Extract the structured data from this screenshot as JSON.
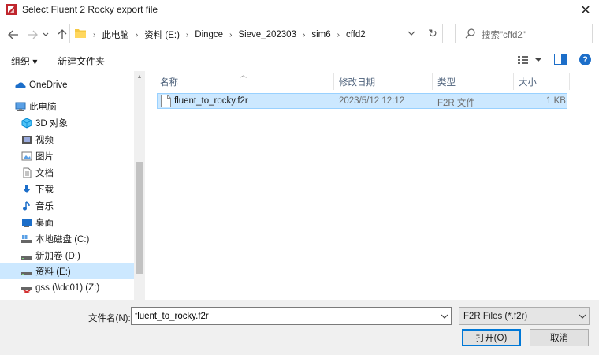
{
  "window": {
    "title": "Select Fluent 2 Rocky export file",
    "close_glyph": "✕"
  },
  "address": {
    "crumbs": [
      "此电脑",
      "资料 (E:)",
      "Dingce",
      "Sieve_202303",
      "sim6",
      "cffd2"
    ],
    "separator": "›",
    "refresh_glyph": "↻"
  },
  "search": {
    "placeholder": "搜索\"cffd2\""
  },
  "toolbar": {
    "organize_label": "组织 ▾",
    "new_folder_label": "新建文件夹",
    "help_glyph": "?"
  },
  "nav": {
    "items": [
      {
        "label": "OneDrive",
        "icon": "cloud-icon"
      },
      {
        "label": "此电脑",
        "icon": "computer-icon"
      },
      {
        "label": "3D 对象",
        "icon": "cube-icon"
      },
      {
        "label": "视频",
        "icon": "video-icon"
      },
      {
        "label": "图片",
        "icon": "picture-icon"
      },
      {
        "label": "文档",
        "icon": "document-icon"
      },
      {
        "label": "下载",
        "icon": "download-icon"
      },
      {
        "label": "音乐",
        "icon": "music-icon"
      },
      {
        "label": "桌面",
        "icon": "desktop-icon"
      },
      {
        "label": "本地磁盘 (C:)",
        "icon": "drive-icon"
      },
      {
        "label": "新加卷 (D:)",
        "icon": "drive-icon"
      },
      {
        "label": "资料 (E:)",
        "icon": "drive-icon",
        "selected": true
      },
      {
        "label": "gss (\\\\dc01) (Z:)",
        "icon": "network-drive-icon"
      }
    ]
  },
  "columns": {
    "name": "名称",
    "modified": "修改日期",
    "type": "类型",
    "size": "大小"
  },
  "files": [
    {
      "name": "fluent_to_rocky.f2r",
      "modified": "2023/5/12 12:12",
      "type": "F2R 文件",
      "size": "1 KB"
    }
  ],
  "footer": {
    "filename_label": "文件名(N):",
    "filename_value": "fluent_to_rocky.f2r",
    "filter_value": "F2R Files (*.f2r)",
    "open_label": "打开(O)",
    "cancel_label": "取消"
  },
  "colors": {
    "accent": "#0078d7",
    "selection": "#cce8ff",
    "app_icon": "#c0262d"
  }
}
